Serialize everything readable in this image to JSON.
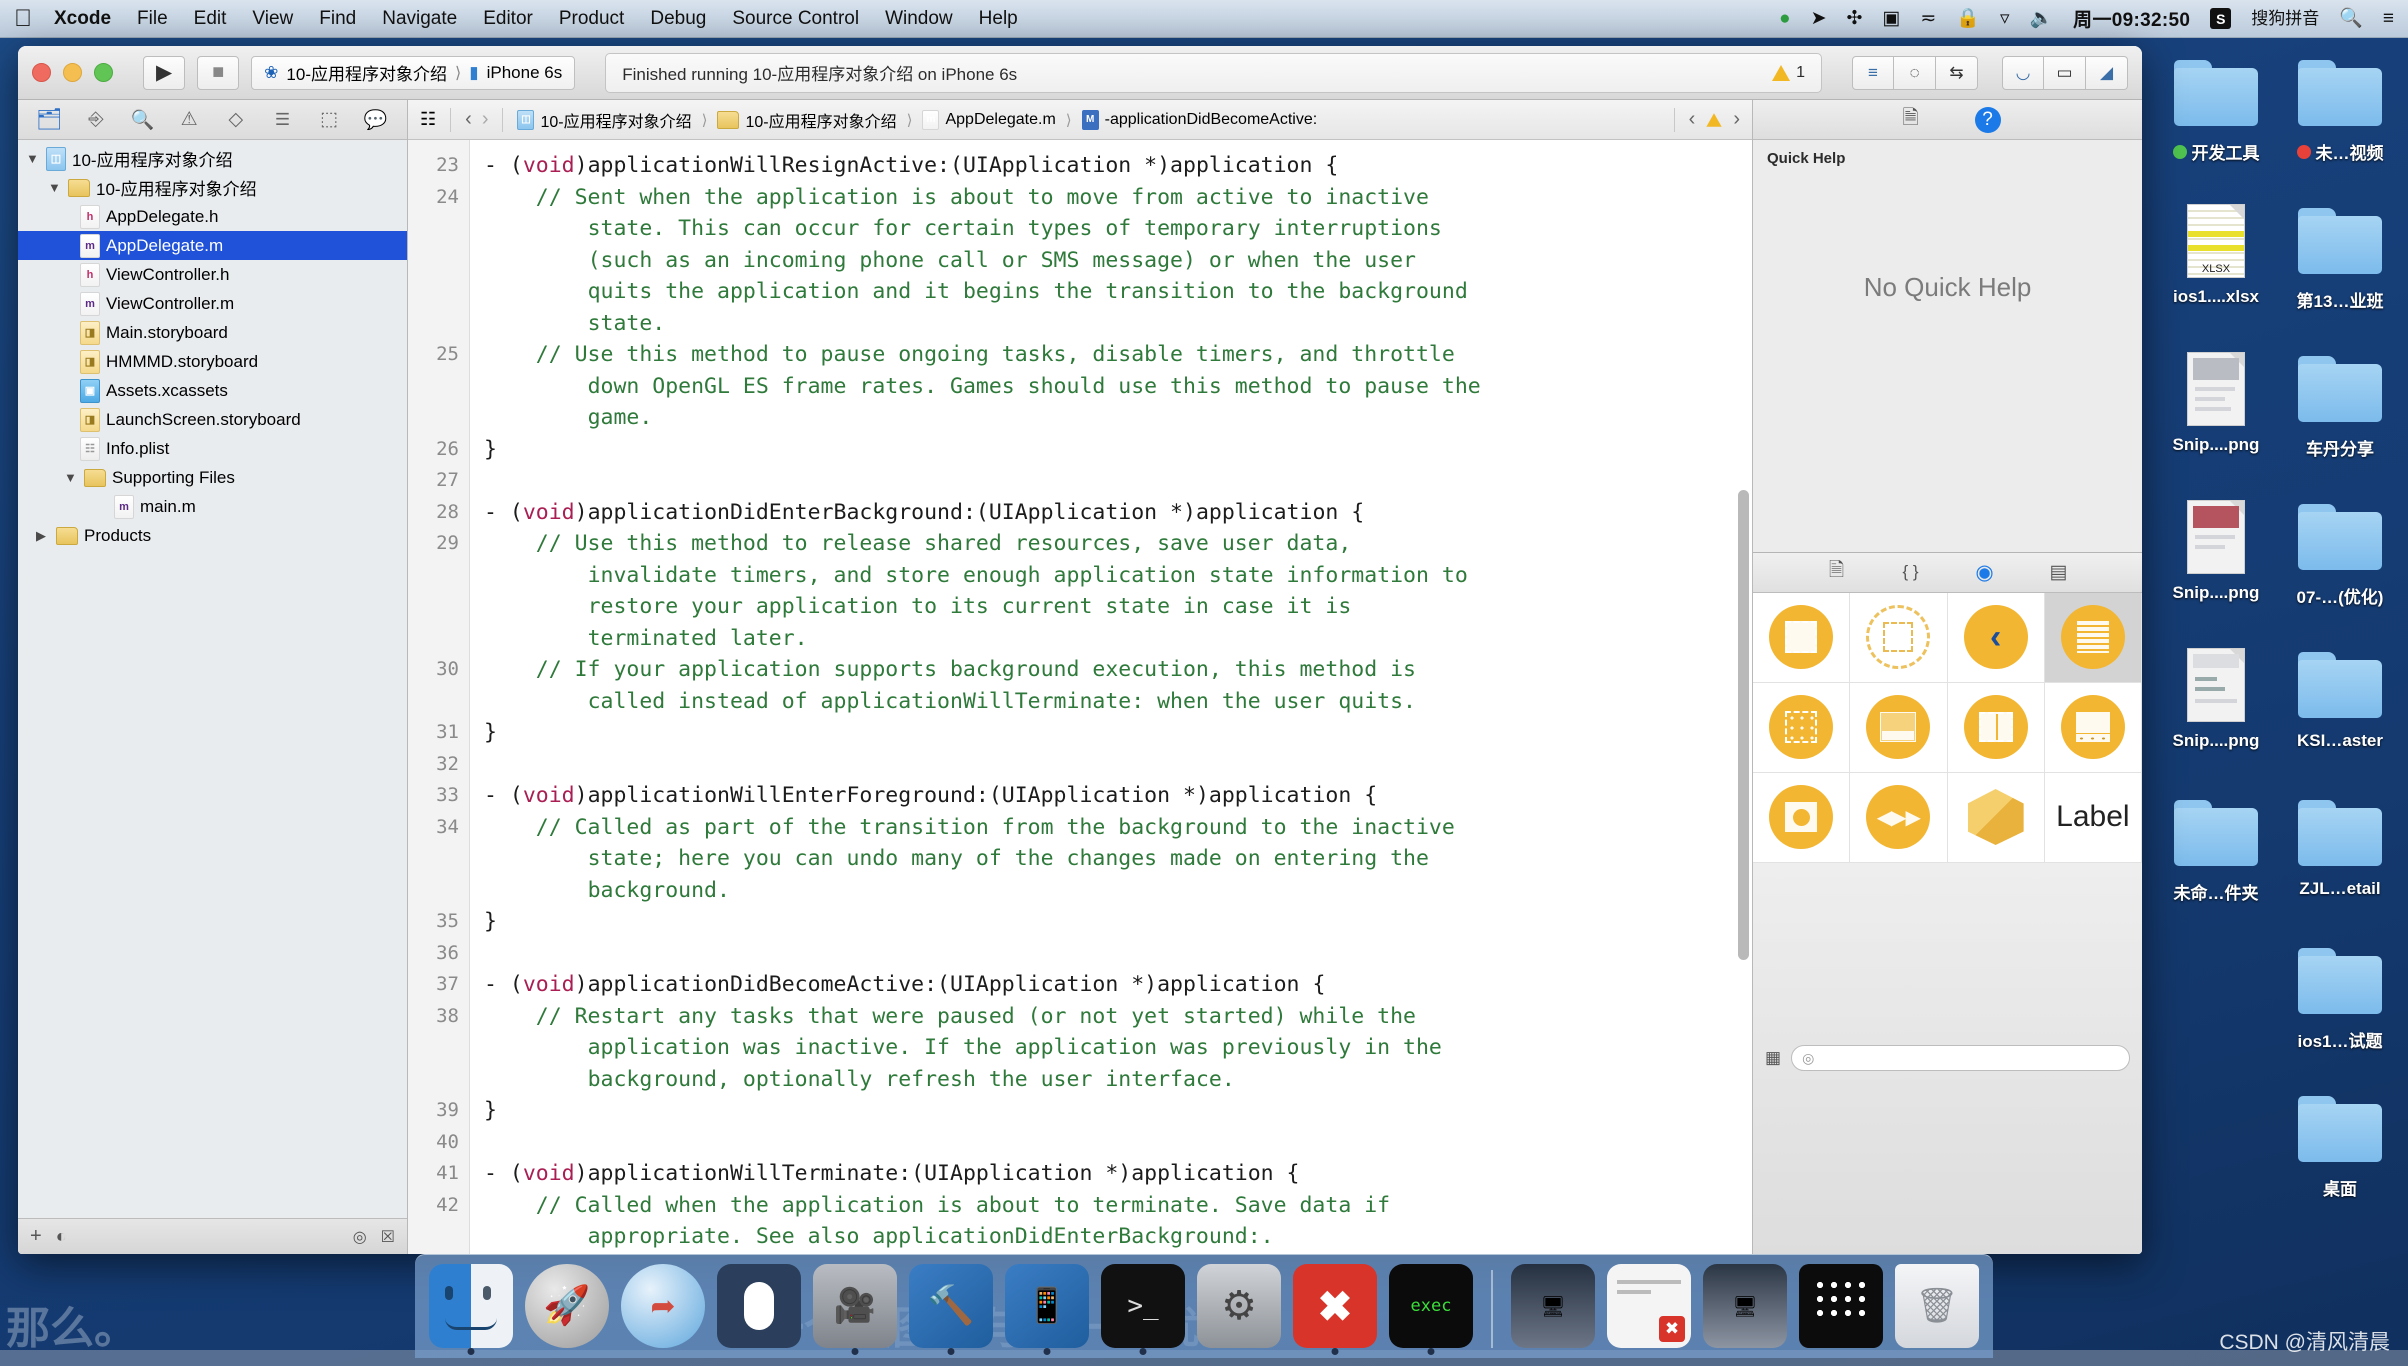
{
  "menubar": {
    "apple_icon": "apple-icon",
    "items": [
      {
        "label": "Xcode",
        "bold": true
      },
      {
        "label": "File",
        "bold": false
      },
      {
        "label": "Edit",
        "bold": false
      },
      {
        "label": "View",
        "bold": false
      },
      {
        "label": "Find",
        "bold": false
      },
      {
        "label": "Navigate",
        "bold": false
      },
      {
        "label": "Editor",
        "bold": false
      },
      {
        "label": "Product",
        "bold": false
      },
      {
        "label": "Debug",
        "bold": false
      },
      {
        "label": "Source Control",
        "bold": false
      },
      {
        "label": "Window",
        "bold": false
      },
      {
        "label": "Help",
        "bold": false
      }
    ],
    "status_items": [
      {
        "name": "sync-icon",
        "glyph": "◕"
      },
      {
        "name": "location-icon",
        "glyph": "➤"
      },
      {
        "name": "bluetooth-icon",
        "glyph": "✣"
      },
      {
        "name": "screen-record-icon",
        "glyph": "▣"
      },
      {
        "name": "input-source-icon",
        "glyph": "⁂"
      },
      {
        "name": "lock-icon",
        "glyph": "🔒"
      },
      {
        "name": "wifi-icon",
        "glyph": "▽"
      },
      {
        "name": "volume-icon",
        "glyph": "🔊"
      }
    ],
    "clock": "周一09:32:50",
    "sogou_badge": "S",
    "input_method": "搜狗拼音",
    "search_icon": "search-icon",
    "notification_icon": "notification-center-icon"
  },
  "desktop": {
    "icons": [
      {
        "label": "开发工具",
        "type": "folder",
        "dot": "#4fc34f"
      },
      {
        "label": "未…视频",
        "type": "folder",
        "dot": "#e8413a"
      },
      {
        "label": "ios1....xlsx",
        "type": "xlsx",
        "dot": ""
      },
      {
        "label": "第13…业班",
        "type": "folder",
        "dot": ""
      },
      {
        "label": "Snip....png",
        "type": "png",
        "dot": ""
      },
      {
        "label": "车丹分享",
        "type": "folder",
        "dot": ""
      },
      {
        "label": "Snip....png",
        "type": "png",
        "dot": ""
      },
      {
        "label": "07-…(优化)",
        "type": "folder",
        "dot": ""
      },
      {
        "label": "Snip....png",
        "type": "png",
        "dot": ""
      },
      {
        "label": "KSI…aster",
        "type": "folder",
        "dot": ""
      },
      {
        "label": "未命…件夹",
        "type": "folder",
        "dot": ""
      },
      {
        "label": "ZJL…etail",
        "type": "folder",
        "dot": ""
      },
      {
        "label": "",
        "type": "empty",
        "dot": ""
      },
      {
        "label": "ios1…试题",
        "type": "folder",
        "dot": ""
      },
      {
        "label": "",
        "type": "empty",
        "dot": ""
      },
      {
        "label": "桌面",
        "type": "folder",
        "dot": ""
      }
    ]
  },
  "xcode": {
    "toolbar": {
      "run_icon": "play-icon",
      "stop_icon": "stop-icon",
      "scheme_project": "10-应用程序对象介绍",
      "scheme_device": "iPhone 6s",
      "status_text": "Finished running 10-应用程序对象介绍 on iPhone 6s",
      "warning_count": "1",
      "editor_buttons": [
        {
          "name": "standard-editor-button",
          "glyph": "≡"
        },
        {
          "name": "assistant-editor-button",
          "glyph": "◎"
        },
        {
          "name": "version-editor-button",
          "glyph": "⇆"
        }
      ],
      "view_buttons": [
        {
          "name": "toggle-navigator-button",
          "glyph": "◧"
        },
        {
          "name": "toggle-debug-area-button",
          "glyph": "⬒"
        },
        {
          "name": "toggle-utilities-button",
          "glyph": "◨"
        }
      ]
    },
    "navigator": {
      "tabs": [
        {
          "name": "project-navigator-tab",
          "glyph": "🗀",
          "selected": true
        },
        {
          "name": "source-control-navigator-tab",
          "glyph": "⑂"
        },
        {
          "name": "symbol-navigator-tab",
          "glyph": "⚲"
        },
        {
          "name": "issue-navigator-tab",
          "glyph": "⚠"
        },
        {
          "name": "test-navigator-tab",
          "glyph": "◇"
        },
        {
          "name": "debug-navigator-tab",
          "glyph": "☷"
        },
        {
          "name": "breakpoint-navigator-tab",
          "glyph": "⬚"
        },
        {
          "name": "report-navigator-tab",
          "glyph": "💬"
        }
      ],
      "items": [
        {
          "label": "10-应用程序对象介绍",
          "indent": 0,
          "twisty": "▼",
          "icon": "project",
          "selected": false
        },
        {
          "label": "10-应用程序对象介绍",
          "indent": 1,
          "twisty": "▼",
          "icon": "folder",
          "selected": false
        },
        {
          "label": "AppDelegate.h",
          "indent": 2,
          "twisty": "",
          "icon": "h",
          "selected": false
        },
        {
          "label": "AppDelegate.m",
          "indent": 2,
          "twisty": "",
          "icon": "m",
          "selected": true
        },
        {
          "label": "ViewController.h",
          "indent": 2,
          "twisty": "",
          "icon": "h",
          "selected": false
        },
        {
          "label": "ViewController.m",
          "indent": 2,
          "twisty": "",
          "icon": "m",
          "selected": false
        },
        {
          "label": "Main.storyboard",
          "indent": 2,
          "twisty": "",
          "icon": "sb",
          "selected": false
        },
        {
          "label": "HMMMD.storyboard",
          "indent": 2,
          "twisty": "",
          "icon": "sb",
          "selected": false
        },
        {
          "label": "Assets.xcassets",
          "indent": 2,
          "twisty": "",
          "icon": "xcassets",
          "selected": false
        },
        {
          "label": "LaunchScreen.storyboard",
          "indent": 2,
          "twisty": "",
          "icon": "sb",
          "selected": false
        },
        {
          "label": "Info.plist",
          "indent": 2,
          "twisty": "",
          "icon": "plist",
          "selected": false
        },
        {
          "label": "Supporting Files",
          "indent": 1,
          "twisty": "▼",
          "icon": "folder",
          "selected": false
        },
        {
          "label": "main.m",
          "indent": 3,
          "twisty": "",
          "icon": "m",
          "selected": false
        },
        {
          "label": "Products",
          "indent": 0,
          "twisty": "▶",
          "icon": "folder",
          "selected": false
        }
      ],
      "bottom": {
        "add_icon": "add-button",
        "filter_icon": "filter-button",
        "right_icons": "◎ ☒"
      }
    },
    "jumpbar": {
      "related_icon": "related-items-icon",
      "back_icon": "‹",
      "forward_icon": "›",
      "crumbs": [
        {
          "label": "10-应用程序对象介绍",
          "icon": "project"
        },
        {
          "label": "10-应用程序对象介绍",
          "icon": "folder"
        },
        {
          "label": "AppDelegate.m",
          "icon": "m"
        },
        {
          "label": "-applicationDidBecomeActive:",
          "icon": "M"
        }
      ],
      "prev_issue_icon": "‹",
      "warning_icon": "warning-triangle-icon",
      "next_issue_icon": "›"
    },
    "code": {
      "first_line": 23,
      "lines": [
        {
          "num": "23",
          "html": "<span class=\"dash\">-</span> (<span class=\"k\">void</span>)applicationWillResignActive:(UIApplication *)application {"
        },
        {
          "num": "24",
          "html": "    <span class=\"c\">// Sent when the application is about to move from active to inactive</span>"
        },
        {
          "num": "",
          "html": "        <span class=\"c\">state. This can occur for certain types of temporary interruptions</span>"
        },
        {
          "num": "",
          "html": "        <span class=\"c\">(such as an incoming phone call or SMS message) or when the user</span>"
        },
        {
          "num": "",
          "html": "        <span class=\"c\">quits the application and it begins the transition to the background</span>"
        },
        {
          "num": "",
          "html": "        <span class=\"c\">state.</span>"
        },
        {
          "num": "25",
          "html": "    <span class=\"c\">// Use this method to pause ongoing tasks, disable timers, and throttle</span>"
        },
        {
          "num": "",
          "html": "        <span class=\"c\">down OpenGL ES frame rates. Games should use this method to pause the</span>"
        },
        {
          "num": "",
          "html": "        <span class=\"c\">game.</span>"
        },
        {
          "num": "26",
          "html": "}"
        },
        {
          "num": "27",
          "html": ""
        },
        {
          "num": "28",
          "html": "<span class=\"dash\">-</span> (<span class=\"k\">void</span>)applicationDidEnterBackground:(UIApplication *)application {"
        },
        {
          "num": "29",
          "html": "    <span class=\"c\">// Use this method to release shared resources, save user data,</span>"
        },
        {
          "num": "",
          "html": "        <span class=\"c\">invalidate timers, and store enough application state information to</span>"
        },
        {
          "num": "",
          "html": "        <span class=\"c\">restore your application to its current state in case it is</span>"
        },
        {
          "num": "",
          "html": "        <span class=\"c\">terminated later.</span>"
        },
        {
          "num": "30",
          "html": "    <span class=\"c\">// If your application supports background execution, this method is</span>"
        },
        {
          "num": "",
          "html": "        <span class=\"c\">called instead of applicationWillTerminate: when the user quits.</span>"
        },
        {
          "num": "31",
          "html": "}"
        },
        {
          "num": "32",
          "html": ""
        },
        {
          "num": "33",
          "html": "<span class=\"dash\">-</span> (<span class=\"k\">void</span>)applicationWillEnterForeground:(UIApplication *)application {"
        },
        {
          "num": "34",
          "html": "    <span class=\"c\">// Called as part of the transition from the background to the inactive</span>"
        },
        {
          "num": "",
          "html": "        <span class=\"c\">state; here you can undo many of the changes made on entering the</span>"
        },
        {
          "num": "",
          "html": "        <span class=\"c\">background.</span>"
        },
        {
          "num": "35",
          "html": "}"
        },
        {
          "num": "36",
          "html": ""
        },
        {
          "num": "37",
          "html": "<span class=\"dash\">-</span> (<span class=\"k\">void</span>)applicationDidBecomeActive:(UIApplication *)application {"
        },
        {
          "num": "38",
          "html": "    <span class=\"c\">// Restart any tasks that were paused (or not yet started) while the</span>"
        },
        {
          "num": "",
          "html": "        <span class=\"c\">application was inactive. If the application was previously in the</span>"
        },
        {
          "num": "",
          "html": "        <span class=\"c\">background, optionally refresh the user interface.</span>"
        },
        {
          "num": "39",
          "html": "}"
        },
        {
          "num": "40",
          "html": ""
        },
        {
          "num": "41",
          "html": "<span class=\"dash\">-</span> (<span class=\"k\">void</span>)applicationWillTerminate:(UIApplication *)application {"
        },
        {
          "num": "42",
          "html": "    <span class=\"c\">// Called when the application is about to terminate. Save data if</span>"
        },
        {
          "num": "",
          "html": "        <span class=\"c\">appropriate. See also applicationDidEnterBackground:.</span>"
        }
      ]
    },
    "utility": {
      "tabs": [
        {
          "name": "file-inspector-tab",
          "glyph": "□",
          "selected": false
        },
        {
          "name": "quick-help-inspector-tab",
          "glyph": "?",
          "selected": true
        }
      ],
      "quick_help": {
        "title": "Quick Help",
        "empty_text": "No Quick Help"
      },
      "library_tabs": [
        {
          "name": "file-template-library-tab",
          "glyph": "□",
          "selected": false
        },
        {
          "name": "code-snippet-library-tab",
          "glyph": "{ }",
          "selected": false
        },
        {
          "name": "object-library-tab",
          "glyph": "◉",
          "selected": true
        },
        {
          "name": "media-library-tab",
          "glyph": "▤",
          "selected": false
        }
      ],
      "library_items": [
        {
          "name": "view-controller-object",
          "kind": "dashed-square",
          "selected": false
        },
        {
          "name": "storyboard-reference-object",
          "kind": "dashed-circle",
          "selected": false
        },
        {
          "name": "navigation-controller-object",
          "kind": "chevron",
          "selected": false
        },
        {
          "name": "table-view-controller-object",
          "kind": "lines",
          "selected": true
        },
        {
          "name": "collection-view-controller-object",
          "kind": "grid",
          "selected": false
        },
        {
          "name": "split-view-controller-object",
          "kind": "split",
          "selected": false
        },
        {
          "name": "page-view-controller-object",
          "kind": "pages",
          "selected": false
        },
        {
          "name": "tab-bar-controller-object",
          "kind": "tabbar",
          "selected": false
        },
        {
          "name": "image-picker-controller-object",
          "kind": "picker",
          "selected": false
        },
        {
          "name": "av-player-controller-object",
          "kind": "player",
          "selected": false
        },
        {
          "name": "gl-kit-view-controller-object",
          "kind": "cube",
          "selected": false
        },
        {
          "name": "label-object",
          "kind": "text",
          "label": "Label",
          "selected": false
        }
      ],
      "library_filter_placeholder": ""
    }
  },
  "dock": {
    "items": [
      {
        "name": "finder-dock-icon",
        "running": true
      },
      {
        "name": "launchpad-dock-icon",
        "running": false
      },
      {
        "name": "safari-dock-icon",
        "running": false
      },
      {
        "name": "mouse-app-dock-icon",
        "running": false
      },
      {
        "name": "quicktime-dock-icon",
        "running": true
      },
      {
        "name": "xcode-dock-icon",
        "running": true
      },
      {
        "name": "xcode-beta-dock-icon",
        "running": true
      },
      {
        "name": "terminal-dock-icon",
        "running": true
      },
      {
        "name": "system-preferences-dock-icon",
        "running": false
      },
      {
        "name": "xmind-dock-icon",
        "running": true
      },
      {
        "name": "console-dock-icon",
        "running": true
      },
      {
        "name": "separator",
        "running": false
      },
      {
        "name": "window-minimized-1",
        "running": false
      },
      {
        "name": "window-minimized-2",
        "running": false
      },
      {
        "name": "window-minimized-3",
        "running": false
      },
      {
        "name": "simulator-minimized",
        "running": false
      },
      {
        "name": "trash-dock-icon",
        "running": false
      }
    ]
  },
  "overlay": {
    "watermark": "CSDN @清风清晨",
    "slide_text_left": "那么。",
    "slide_text_right": "一个类图制与哪一种优化"
  }
}
